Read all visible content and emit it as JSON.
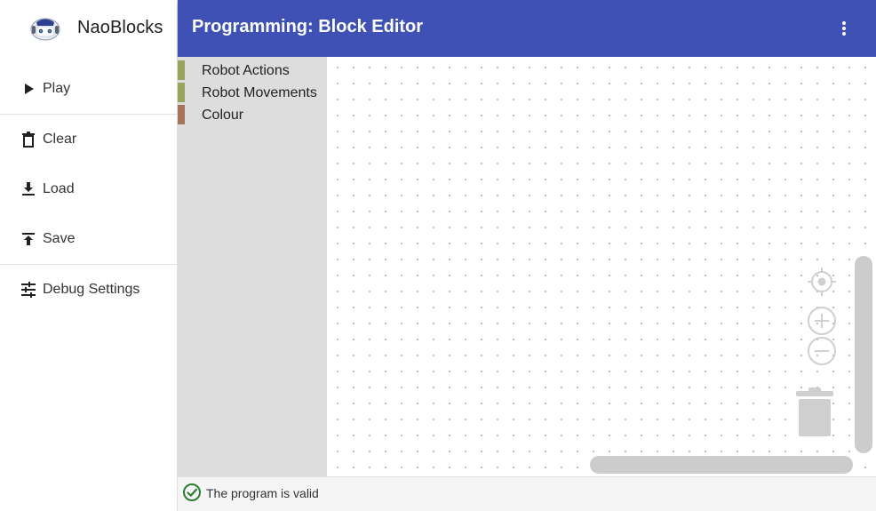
{
  "app": {
    "name": "NaoBlocks",
    "logo_icon": "nao-robot-icon"
  },
  "sidebar": {
    "items": [
      {
        "label": "Play",
        "icon": "play-icon"
      },
      {
        "label": "Clear",
        "icon": "trash-icon"
      },
      {
        "label": "Load",
        "icon": "download-icon"
      },
      {
        "label": "Save",
        "icon": "upload-icon"
      },
      {
        "label": "Debug Settings",
        "icon": "tune-icon"
      }
    ]
  },
  "header": {
    "title": "Programming: Block Editor",
    "menu_icon": "more-vert-icon",
    "color": "#3f51b5"
  },
  "toolbox": {
    "categories": [
      {
        "label": "Robot Actions",
        "color": "#9aa35b"
      },
      {
        "label": "Robot Movements",
        "color": "#9aa35b"
      },
      {
        "label": "Colour",
        "color": "#a5745b"
      }
    ]
  },
  "workspace": {
    "controls": [
      {
        "icon": "recenter-icon"
      },
      {
        "icon": "zoom-in-icon"
      },
      {
        "icon": "zoom-out-icon"
      },
      {
        "icon": "trash-icon"
      }
    ]
  },
  "status": {
    "text": "The program is valid",
    "icon": "check-circle-icon",
    "color": "#2e7d32"
  }
}
